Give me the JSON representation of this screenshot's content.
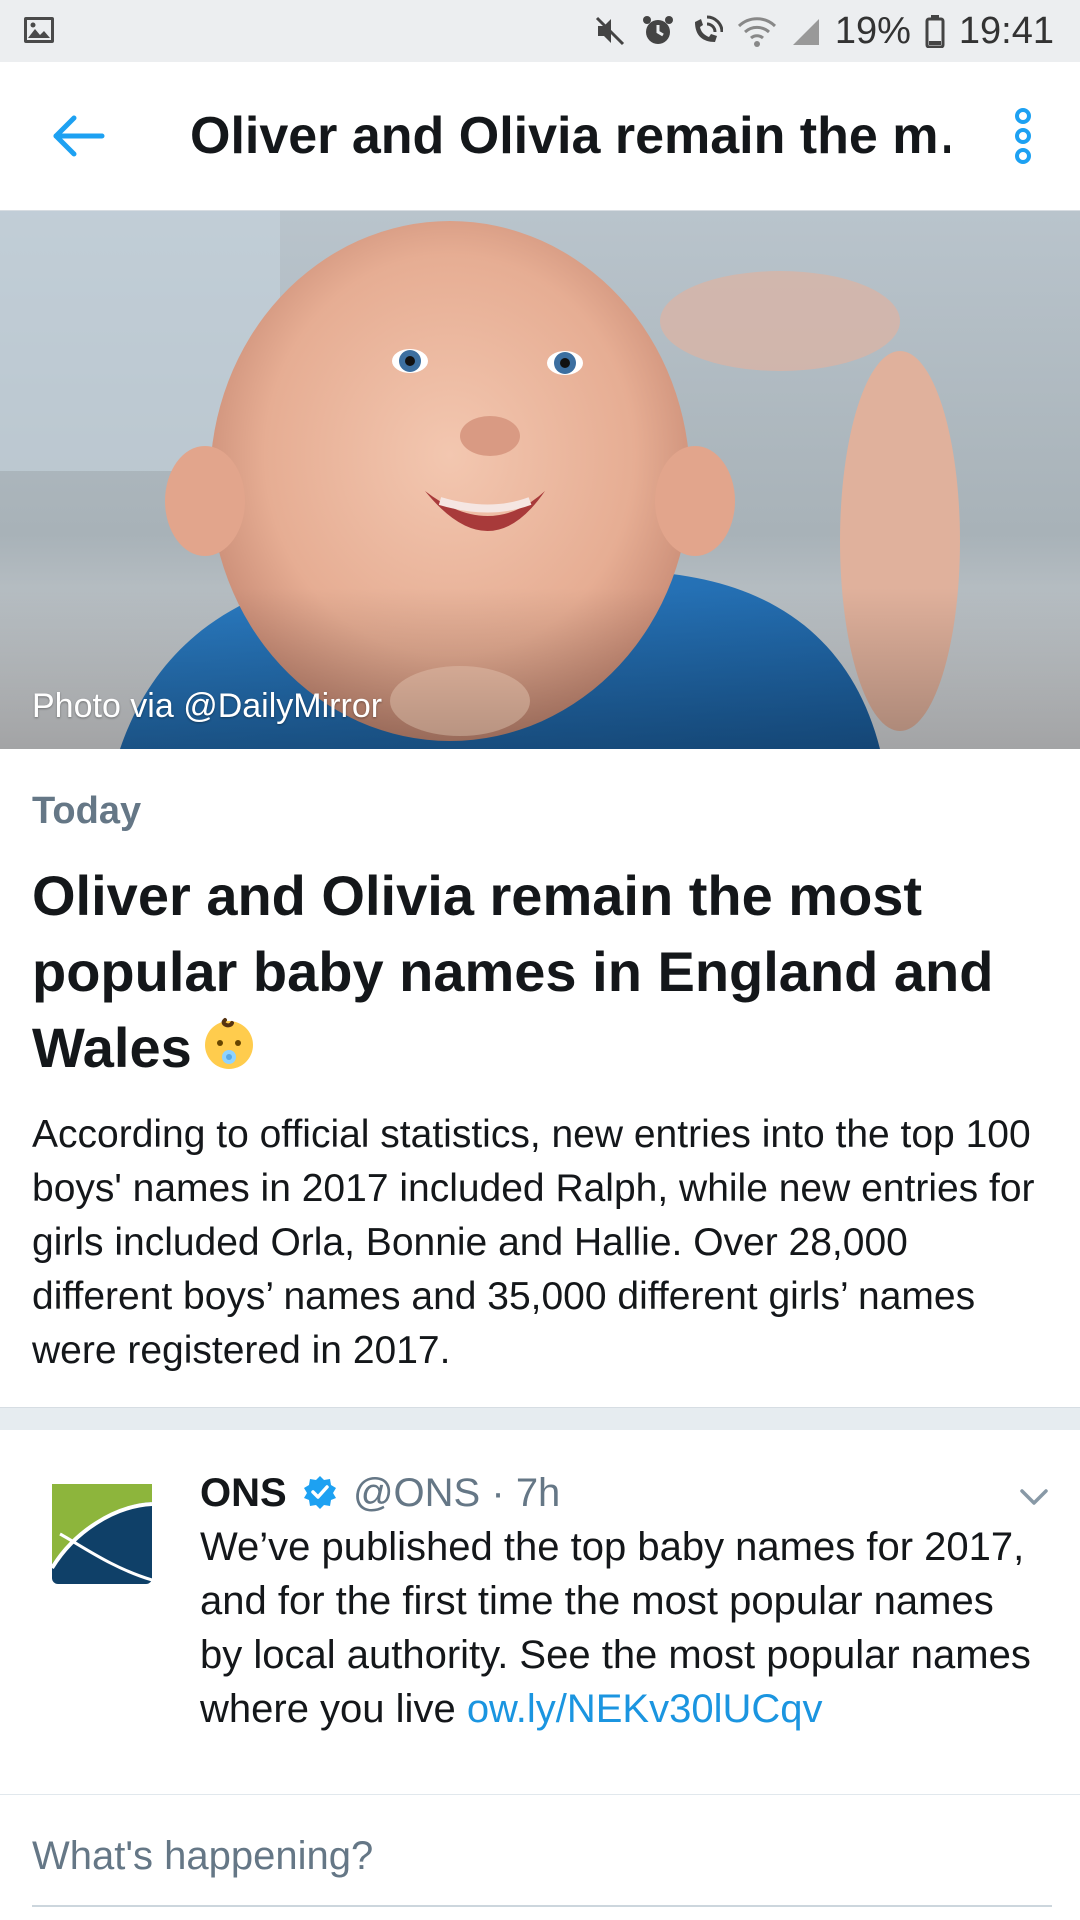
{
  "status_bar": {
    "battery": "19%",
    "time": "19:41"
  },
  "app_bar": {
    "title": "Oliver and Olivia remain the m…"
  },
  "hero": {
    "credit": "Photo via @DailyMirror"
  },
  "article": {
    "date_label": "Today",
    "headline": "Oliver and Olivia remain the most popular baby names in England and Wales",
    "summary": "According to official statistics, new entries into the top 100 boys' names in 2017 included Ralph, while new entries for girls included Orla, Bonnie and Hallie. Over 28,000 different boys’ names and 35,000 different girls’ names were registered in 2017."
  },
  "tweet": {
    "name": "ONS",
    "handle": "@ONS",
    "separator": "·",
    "time": "7h",
    "text": "We’ve published the top baby names for 2017, and for the first time the most popular names by local authority. See the most popular names where you live",
    "link": "ow.ly/​NEKv30lUCqv"
  },
  "compose": {
    "placeholder": "What's happening?"
  },
  "colors": {
    "accent": "#1da1f2",
    "link": "#1b95e0",
    "secondary_text": "#657786",
    "avatar_green": "#8db53c",
    "avatar_navy": "#0f4068"
  }
}
